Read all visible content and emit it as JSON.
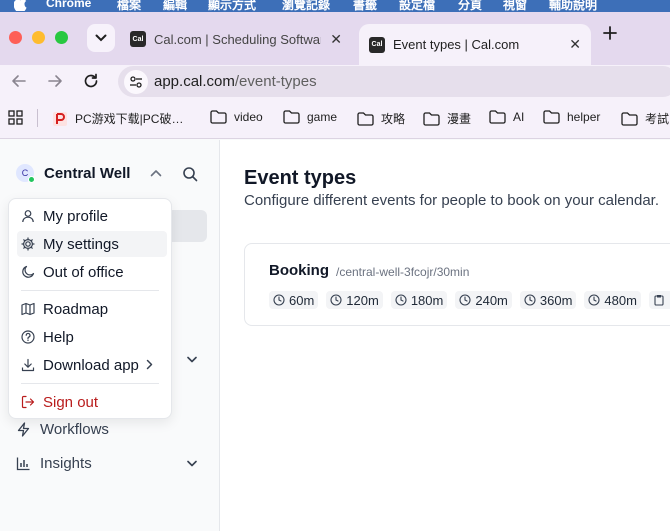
{
  "menubar": {
    "app": "Chrome",
    "items": [
      "檔案",
      "編輯",
      "顯示方式",
      "瀏覽記錄",
      "書籤",
      "設定檔",
      "分頁",
      "視窗",
      "輔助說明"
    ]
  },
  "tabs": [
    {
      "title": "Cal.com | Scheduling Softwar",
      "favicon": "Cal",
      "active": false
    },
    {
      "title": "Event types | Cal.com",
      "favicon": "Cal",
      "active": true
    }
  ],
  "toolbar": {
    "url_domain": "app.cal.com",
    "url_path": "/event-types"
  },
  "bookmarks": [
    {
      "label": "PC游戏下载|PC破…",
      "icon": "game-site-icon"
    },
    {
      "label": "video",
      "icon": "folder-icon"
    },
    {
      "label": "game",
      "icon": "folder-icon"
    },
    {
      "label": "攻略",
      "icon": "folder-icon"
    },
    {
      "label": "漫畫",
      "icon": "folder-icon"
    },
    {
      "label": "AI",
      "icon": "folder-icon"
    },
    {
      "label": "helper",
      "icon": "folder-icon"
    },
    {
      "label": "考試",
      "icon": "folder-icon"
    }
  ],
  "sidebar": {
    "org_initial": "C",
    "org_name": "Central Well",
    "nav": [
      {
        "label": "Workflows",
        "icon": "zap-icon"
      },
      {
        "label": "Insights",
        "icon": "bar-chart-icon"
      }
    ]
  },
  "user_menu": {
    "items": [
      {
        "label": "My profile",
        "icon": "user-icon"
      },
      {
        "label": "My settings",
        "icon": "settings-icon"
      },
      {
        "label": "Out of office",
        "icon": "moon-icon"
      },
      {
        "label": "Roadmap",
        "icon": "map-icon"
      },
      {
        "label": "Help",
        "icon": "help-circle-icon"
      },
      {
        "label": "Download app",
        "icon": "download-icon"
      },
      {
        "label": "Sign out",
        "icon": "log-out-icon"
      }
    ]
  },
  "main": {
    "title": "Event types",
    "subtitle": "Configure different events for people to book on your calendar.",
    "event": {
      "title": "Booking",
      "slug": "/central-well-3fcojr/30min",
      "durations": [
        "60m",
        "120m",
        "180m",
        "240m",
        "360m",
        "480m"
      ]
    }
  },
  "colors": {
    "menubar": "#3d6fb8",
    "tabstrip": "#e4d9ee",
    "danger": "#b91c1c",
    "online": "#22c55e"
  }
}
